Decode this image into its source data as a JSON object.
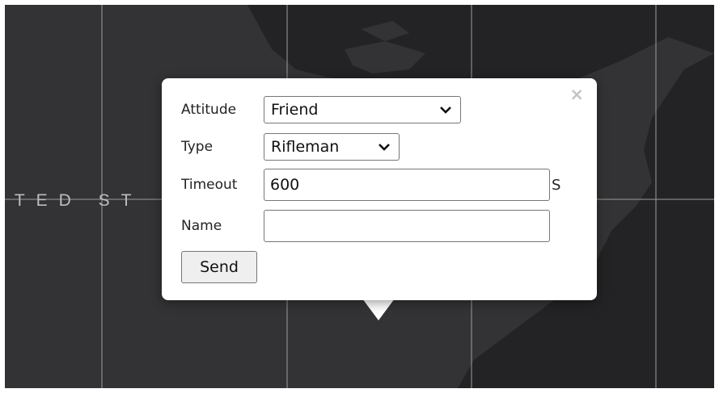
{
  "map": {
    "country_label": "ITED ST",
    "colors": {
      "water": "#333335",
      "land": "#232325",
      "graticule": "#9c9c9c"
    }
  },
  "popup": {
    "close_symbol": "×",
    "fields": {
      "attitude": {
        "label": "Attitude",
        "value": "Friend"
      },
      "type": {
        "label": "Type",
        "value": "Rifleman"
      },
      "timeout": {
        "label": "Timeout",
        "value": "600",
        "unit": "S"
      },
      "name": {
        "label": "Name",
        "value": "",
        "placeholder": ""
      }
    },
    "send_label": "Send"
  }
}
